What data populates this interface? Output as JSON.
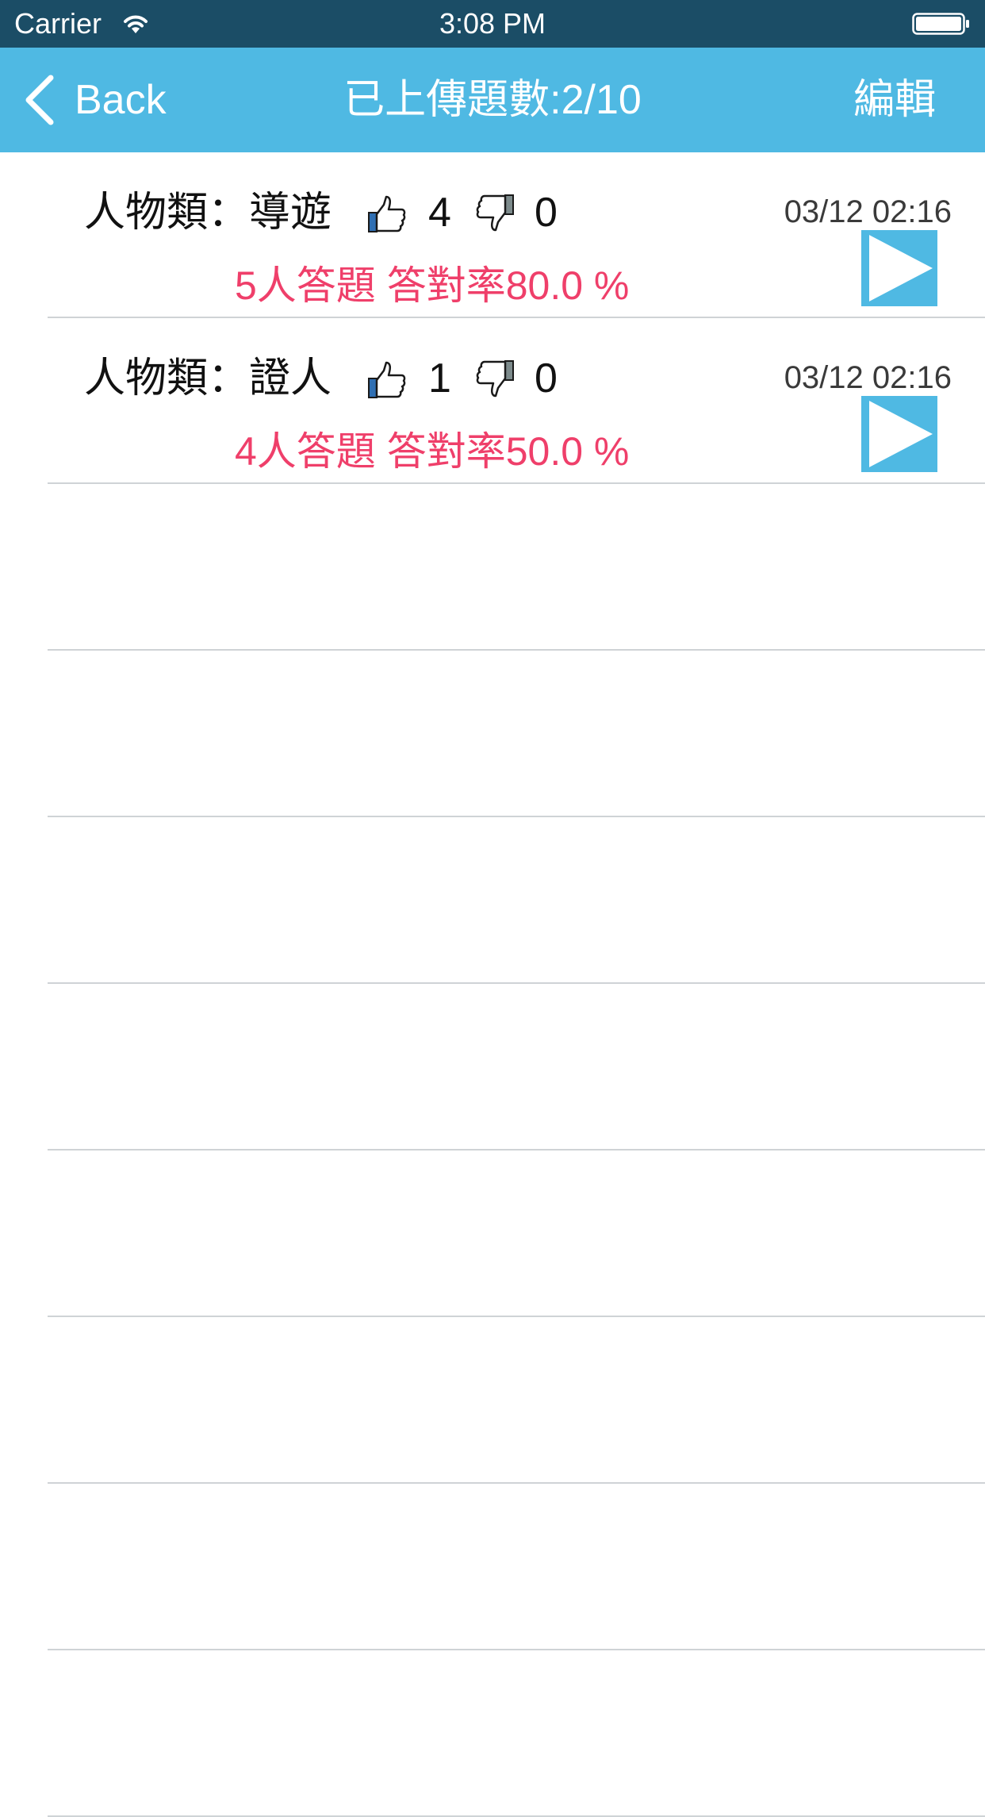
{
  "status_bar": {
    "carrier": "Carrier",
    "time": "3:08 PM"
  },
  "nav": {
    "back_label": "Back",
    "title": "已上傳題數:2/10",
    "edit_label": "編輯"
  },
  "colors": {
    "status_bar_bg": "#1b4d66",
    "nav_bg": "#4fb9e3",
    "stats_text": "#ef3f6a",
    "play_button": "#4fb9e3",
    "separator": "#cfd3d6"
  },
  "questions": [
    {
      "title": "人物類：導遊",
      "likes": "4",
      "dislikes": "0",
      "stats": "5人答題 答對率80.0 %",
      "time": "03/12 02:16"
    },
    {
      "title": "人物類：證人",
      "likes": "1",
      "dislikes": "0",
      "stats": "4人答題 答對率50.0 %",
      "time": "03/12 02:16"
    }
  ],
  "icons": {
    "back": "chevron-left-icon",
    "like": "thumbs-up-icon",
    "dislike": "thumbs-down-icon",
    "play": "play-icon",
    "wifi": "wifi-icon",
    "battery": "battery-icon"
  }
}
